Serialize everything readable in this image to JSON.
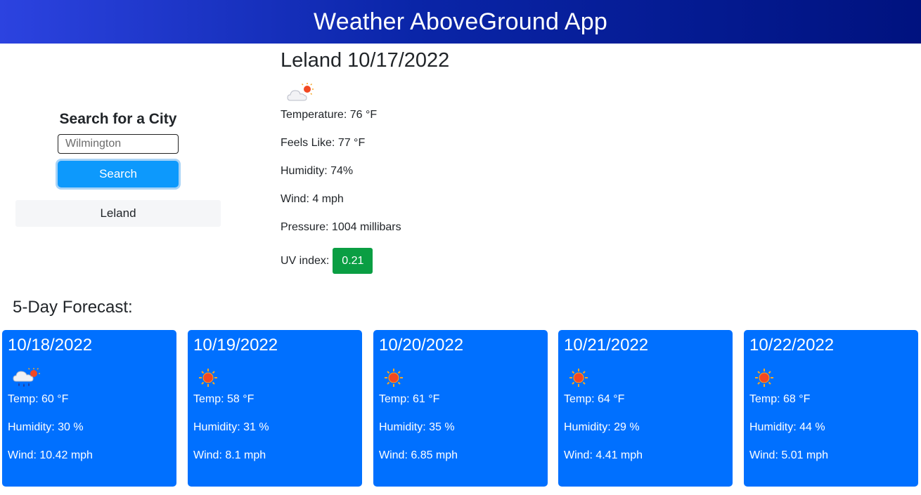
{
  "header": {
    "title": "Weather AboveGround App"
  },
  "search": {
    "heading": "Search for a City",
    "placeholder": "Wilmington",
    "button_label": "Search",
    "history": [
      "Leland"
    ]
  },
  "current": {
    "title": "Leland 10/17/2022",
    "icon": "partly-cloudy-sun-icon",
    "temperature": "Temperature: 76 °F",
    "feels_like": "Feels Like: 77 °F",
    "humidity": "Humidity: 74%",
    "wind": "Wind: 4 mph",
    "pressure": "Pressure: 1004 millibars",
    "uv_label": "UV index:",
    "uv_value": "0.21",
    "uv_color": "#0a9e43"
  },
  "forecast": {
    "title": "5-Day Forecast:",
    "card_color": "#0070ff",
    "days": [
      {
        "date": "10/18/2022",
        "icon": "rain-sun-icon",
        "temp": "Temp: 60 °F",
        "humidity": "Humidity: 30 %",
        "wind": "Wind: 10.42 mph"
      },
      {
        "date": "10/19/2022",
        "icon": "sun-icon",
        "temp": "Temp: 58 °F",
        "humidity": "Humidity: 31 %",
        "wind": "Wind: 8.1 mph"
      },
      {
        "date": "10/20/2022",
        "icon": "sun-icon",
        "temp": "Temp: 61 °F",
        "humidity": "Humidity: 35 %",
        "wind": "Wind: 6.85 mph"
      },
      {
        "date": "10/21/2022",
        "icon": "sun-icon",
        "temp": "Temp: 64 °F",
        "humidity": "Humidity: 29 %",
        "wind": "Wind: 4.41 mph"
      },
      {
        "date": "10/22/2022",
        "icon": "sun-icon",
        "temp": "Temp: 68 °F",
        "humidity": "Humidity: 44 %",
        "wind": "Wind: 5.01 mph"
      }
    ]
  }
}
